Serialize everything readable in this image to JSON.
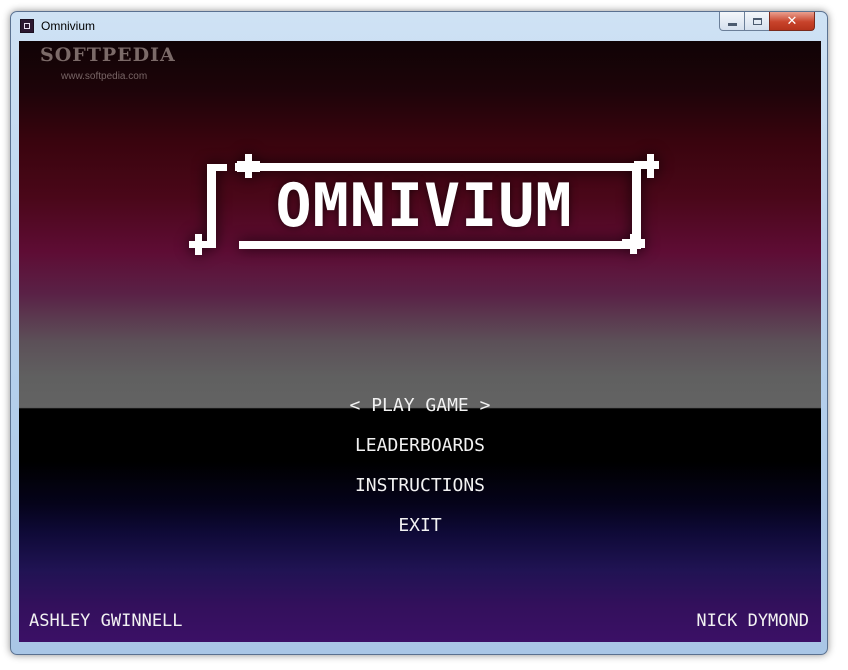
{
  "window": {
    "title": "Omnivium",
    "app_icon": "omnivium-app-icon",
    "controls": {
      "minimize": "minimize-icon",
      "maximize": "maximize-icon",
      "close": "✕"
    }
  },
  "watermark": {
    "name": "SOFTPEDIA",
    "url": "www.softpedia.com"
  },
  "game": {
    "logo_text": "OMNIVIUM",
    "menu": [
      {
        "label": "< PLAY GAME >",
        "selected": true
      },
      {
        "label": "LEADERBOARDS",
        "selected": false
      },
      {
        "label": "INSTRUCTIONS",
        "selected": false
      },
      {
        "label": "EXIT",
        "selected": false
      }
    ],
    "credits": {
      "left": "ASHLEY GWINNELL",
      "right": "NICK DYMOND"
    }
  },
  "colors": {
    "text": "#f2f2f2",
    "logo": "#ffffff",
    "bg_top": "#100305",
    "bg_crimson": "#4a0719",
    "bg_magenta": "#5e0c34",
    "bg_grey": "#636363",
    "bg_black": "#000000",
    "bg_navy": "#0f0a38",
    "bg_purple": "#3b1066"
  }
}
